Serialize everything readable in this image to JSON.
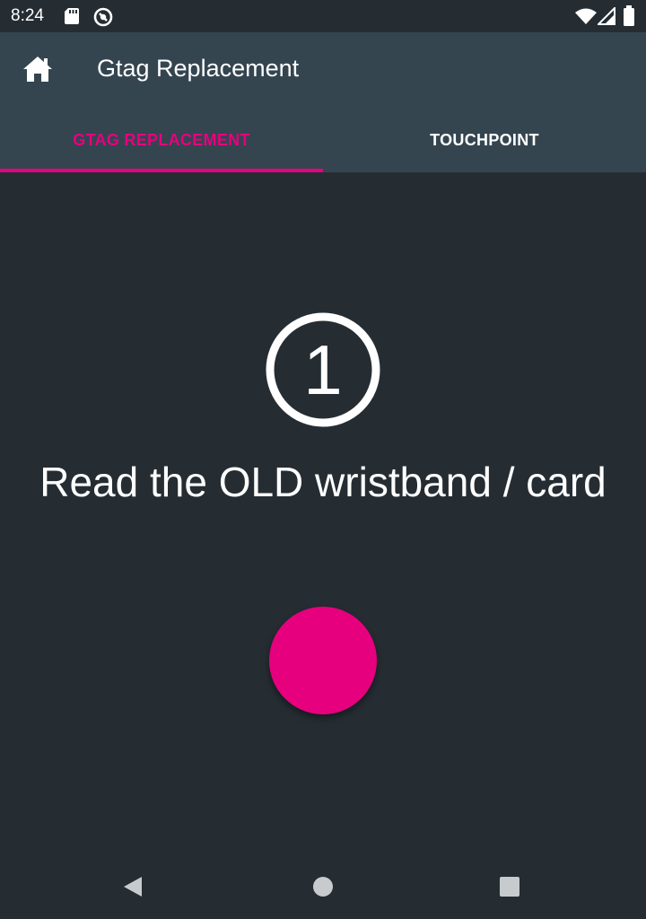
{
  "status_bar": {
    "time": "8:24",
    "icons": [
      "sd-card-icon",
      "sync-icon",
      "wifi-icon",
      "signal-icon",
      "battery-icon"
    ]
  },
  "app_bar": {
    "title": "Gtag Replacement",
    "home_icon": "home-icon"
  },
  "tabs": [
    {
      "label": "GTAG REPLACEMENT",
      "selected": true
    },
    {
      "label": "TOUCHPOINT",
      "selected": false
    }
  ],
  "main": {
    "step_number": "1",
    "instruction": "Read the OLD wristband / card"
  },
  "nav_bar": {
    "icons": [
      "back-icon",
      "home-nav-icon",
      "recents-icon"
    ]
  },
  "colors": {
    "accent": "#e6007e",
    "app_bar": "#344550",
    "background": "#252d33",
    "text": "#ffffff"
  }
}
